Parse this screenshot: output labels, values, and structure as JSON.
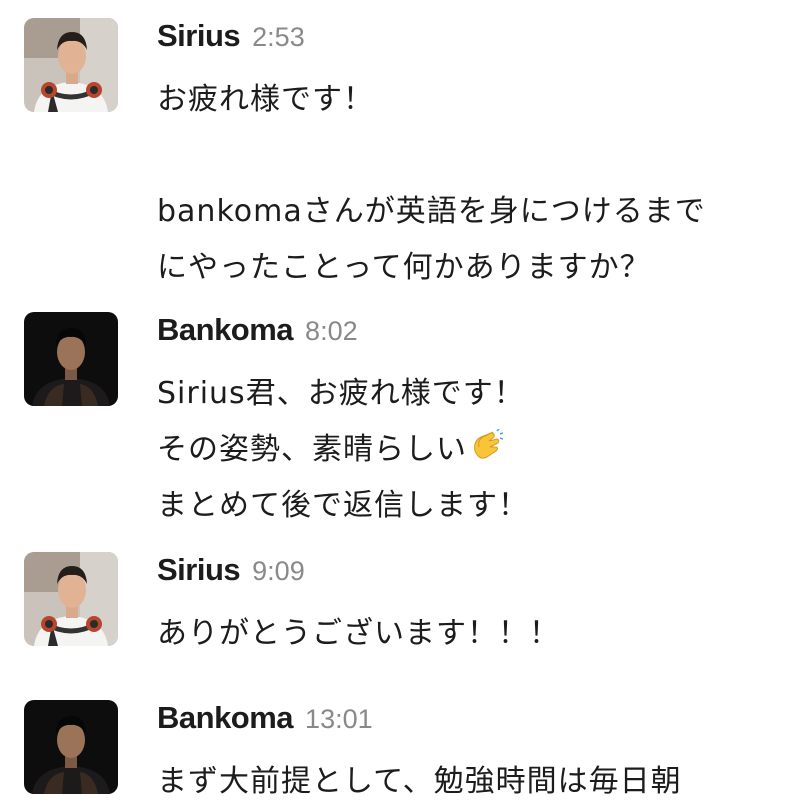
{
  "messages": [
    {
      "sender": "Sirius",
      "time": "2:53",
      "avatar": "sirius-avatar-headphones",
      "lines": [
        "お疲れ様です！",
        "",
        "bankomaさんが英語を身につけるまで",
        "にやったことって何かありますか？"
      ]
    },
    {
      "sender": "Bankoma",
      "time": "8:02",
      "avatar": "bankoma-avatar-dark",
      "lines": [
        "Sirius君、お疲れ様です！",
        "その姿勢、素晴らしい",
        "まとめて後で返信します！"
      ],
      "emoji": "clapping-hands-icon"
    },
    {
      "sender": "Sirius",
      "time": "9:09",
      "avatar": "sirius-avatar-headphones",
      "lines": [
        "ありがとうございます！！！"
      ]
    },
    {
      "sender": "Bankoma",
      "time": "13:01",
      "avatar": "bankoma-avatar-dark",
      "lines": [
        "まず大前提として、勉強時間は毎日朝"
      ]
    }
  ]
}
